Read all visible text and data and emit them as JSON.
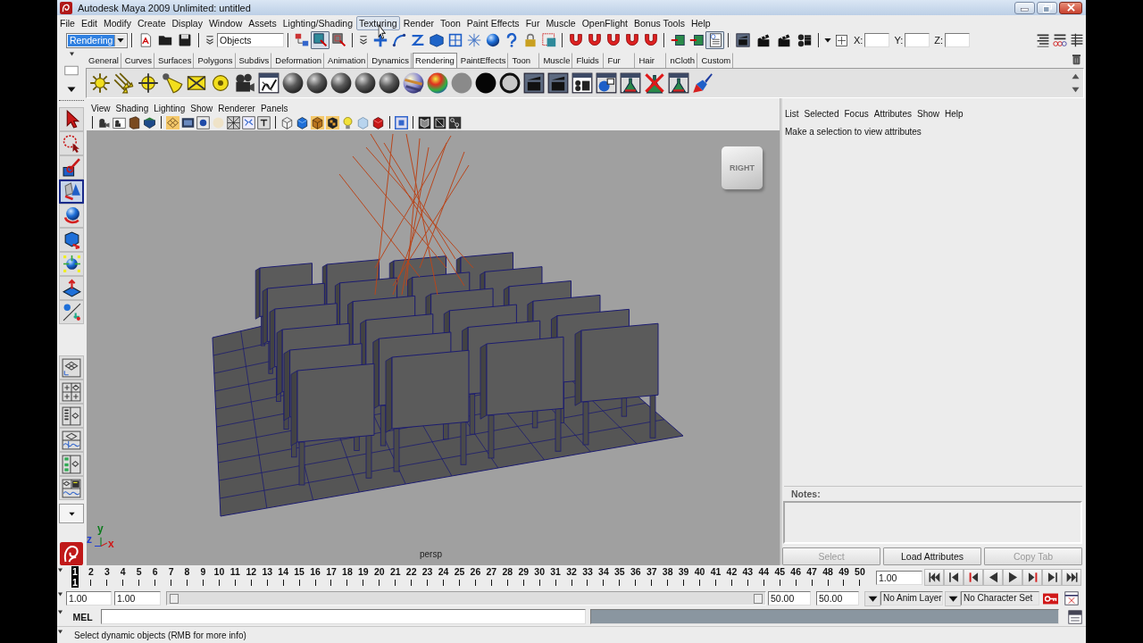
{
  "window": {
    "title": "Autodesk Maya 2009 Unlimited: untitled"
  },
  "menu_bar": [
    {
      "label": "File",
      "highlighted": false
    },
    {
      "label": "Edit",
      "highlighted": false
    },
    {
      "label": "Modify",
      "highlighted": false
    },
    {
      "label": "Create",
      "highlighted": false
    },
    {
      "label": "Display",
      "highlighted": false
    },
    {
      "label": "Window",
      "highlighted": false
    },
    {
      "label": "Assets",
      "highlighted": false
    },
    {
      "label": "Lighting/Shading",
      "highlighted": false
    },
    {
      "label": "Texturing",
      "highlighted": true
    },
    {
      "label": "Render",
      "highlighted": false
    },
    {
      "label": "Toon",
      "highlighted": false
    },
    {
      "label": "Paint Effects",
      "highlighted": false
    },
    {
      "label": "Fur",
      "highlighted": false
    },
    {
      "label": "Muscle",
      "highlighted": false
    },
    {
      "label": "OpenFlight",
      "highlighted": false
    },
    {
      "label": "Bonus Tools",
      "highlighted": false
    },
    {
      "label": "Help",
      "highlighted": false
    }
  ],
  "status_line": {
    "menu_set": "Rendering",
    "selection_mask": "Objects",
    "selection_modes": [
      {
        "selected": false
      },
      {
        "selected": true
      },
      {
        "selected": false
      }
    ],
    "history_toggle": {
      "on": true
    },
    "coordinate_labels": [
      "X:",
      "Y:",
      "Z:"
    ]
  },
  "shelf": {
    "tabs": [
      {
        "label": "General",
        "selected": false
      },
      {
        "label": "Curves",
        "selected": false
      },
      {
        "label": "Surfaces",
        "selected": false
      },
      {
        "label": "Polygons",
        "selected": false
      },
      {
        "label": "Subdivs",
        "selected": false
      },
      {
        "label": "Deformation",
        "selected": false
      },
      {
        "label": "Animation",
        "selected": false
      },
      {
        "label": "Dynamics",
        "selected": false
      },
      {
        "label": "Rendering",
        "selected": true
      },
      {
        "label": "PaintEffects",
        "selected": false
      },
      {
        "label": "Toon",
        "selected": false
      },
      {
        "label": "Muscle",
        "selected": false
      },
      {
        "label": "Fluids",
        "selected": false
      },
      {
        "label": "Fur",
        "selected": false
      },
      {
        "label": "Hair",
        "selected": false
      },
      {
        "label": "nCloth",
        "selected": false
      },
      {
        "label": "Custom",
        "selected": false
      }
    ]
  },
  "toolbox": {
    "tools": [
      {
        "selected": false
      },
      {
        "selected": false
      },
      {
        "selected": false
      },
      {
        "selected": true
      },
      {
        "selected": false
      },
      {
        "selected": false
      },
      {
        "selected": false
      },
      {
        "selected": false
      },
      {
        "selected": false
      }
    ]
  },
  "viewport": {
    "menu": [
      "View",
      "Shading",
      "Lighting",
      "Show",
      "Renderer",
      "Panels"
    ],
    "view_cube_label": "RIGHT",
    "axis_labels": [
      {
        "label": "y",
        "color": "#0a7a1a"
      },
      {
        "label": "z",
        "color": "#1e3cd2"
      },
      {
        "label": "x",
        "color": "#d01818"
      }
    ],
    "camera_label": "persp"
  },
  "attribute_editor": {
    "menu": [
      "List",
      "Selected",
      "Focus",
      "Attributes",
      "Show",
      "Help"
    ],
    "message": "Make a selection to view attributes",
    "notes_label": "Notes:",
    "buttons": [
      {
        "label": "Select",
        "disabled": true
      },
      {
        "label": "Load Attributes",
        "disabled": false
      },
      {
        "label": "Copy Tab",
        "disabled": true
      }
    ]
  },
  "time_slider": {
    "frames": [
      {
        "label": "1",
        "selected": true
      },
      {
        "label": "2",
        "selected": false
      },
      {
        "label": "3",
        "selected": false
      },
      {
        "label": "4",
        "selected": false
      },
      {
        "label": "5",
        "selected": false
      },
      {
        "label": "6",
        "selected": false
      },
      {
        "label": "7",
        "selected": false
      },
      {
        "label": "8",
        "selected": false
      },
      {
        "label": "9",
        "selected": false
      },
      {
        "label": "10",
        "selected": false
      },
      {
        "label": "11",
        "selected": false
      },
      {
        "label": "12",
        "selected": false
      },
      {
        "label": "13",
        "selected": false
      },
      {
        "label": "14",
        "selected": false
      },
      {
        "label": "15",
        "selected": false
      },
      {
        "label": "16",
        "selected": false
      },
      {
        "label": "17",
        "selected": false
      },
      {
        "label": "18",
        "selected": false
      },
      {
        "label": "19",
        "selected": false
      },
      {
        "label": "20",
        "selected": false
      },
      {
        "label": "21",
        "selected": false
      },
      {
        "label": "22",
        "selected": false
      },
      {
        "label": "23",
        "selected": false
      },
      {
        "label": "24",
        "selected": false
      },
      {
        "label": "25",
        "selected": false
      },
      {
        "label": "26",
        "selected": false
      },
      {
        "label": "27",
        "selected": false
      },
      {
        "label": "28",
        "selected": false
      },
      {
        "label": "29",
        "selected": false
      },
      {
        "label": "30",
        "selected": false
      },
      {
        "label": "31",
        "selected": false
      },
      {
        "label": "32",
        "selected": false
      },
      {
        "label": "33",
        "selected": false
      },
      {
        "label": "34",
        "selected": false
      },
      {
        "label": "35",
        "selected": false
      },
      {
        "label": "36",
        "selected": false
      },
      {
        "label": "37",
        "selected": false
      },
      {
        "label": "38",
        "selected": false
      },
      {
        "label": "39",
        "selected": false
      },
      {
        "label": "40",
        "selected": false
      },
      {
        "label": "41",
        "selected": false
      },
      {
        "label": "42",
        "selected": false
      },
      {
        "label": "43",
        "selected": false
      },
      {
        "label": "44",
        "selected": false
      },
      {
        "label": "45",
        "selected": false
      },
      {
        "label": "46",
        "selected": false
      },
      {
        "label": "47",
        "selected": false
      },
      {
        "label": "48",
        "selected": false
      },
      {
        "label": "49",
        "selected": false
      },
      {
        "label": "50",
        "selected": false
      }
    ],
    "current_frame": "1",
    "current_time": "1.00"
  },
  "range_slider": {
    "start_time": "1.00",
    "playback_start": "1.00",
    "playback_end": "50.00",
    "end_time": "50.00",
    "anim_layer": "No Anim Layer",
    "character_set": "No Character Set"
  },
  "command_line": {
    "label": "MEL"
  },
  "help_line": {
    "text": "Select dynamic objects (RMB for more info)"
  }
}
